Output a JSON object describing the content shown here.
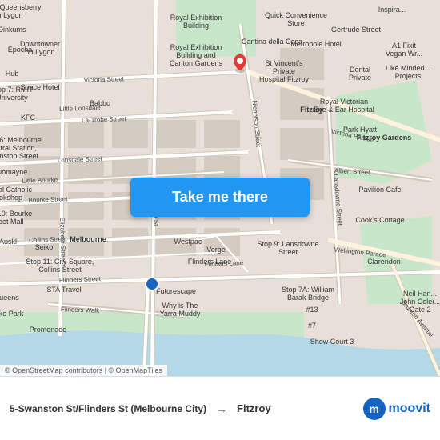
{
  "map": {
    "center_lat": -37.818,
    "center_lng": 144.967,
    "zoom": 14
  },
  "button": {
    "label": "Take me there"
  },
  "bottom_bar": {
    "from": "5-Swanston St/Flinders St (Melbourne City)",
    "arrow": "→",
    "to": "Fitzroy",
    "copyright": "© OpenStreetMap contributors | © OpenMapTiles",
    "logo": "moovit"
  }
}
